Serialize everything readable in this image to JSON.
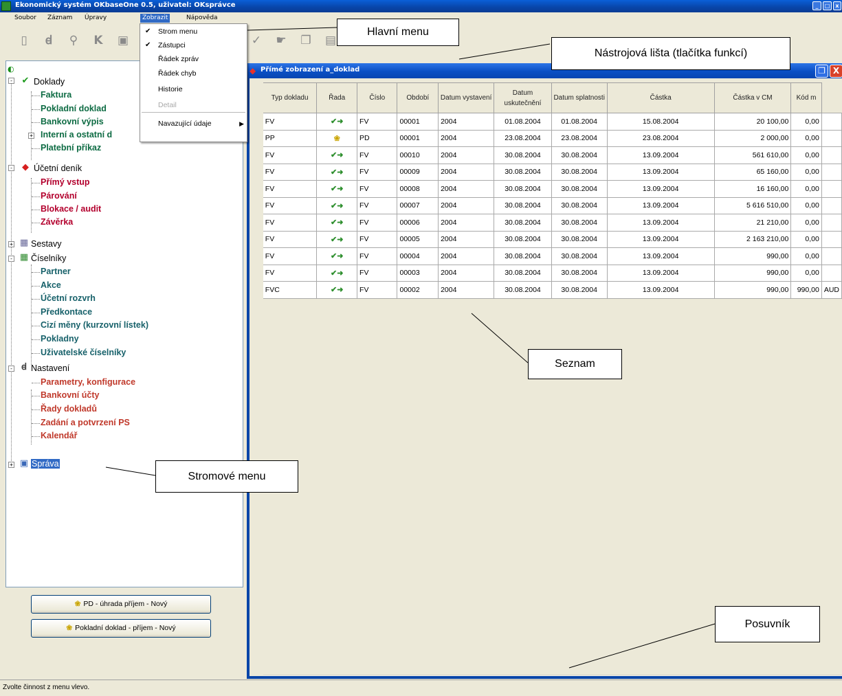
{
  "window": {
    "title": "Ekonomický systém OKbaseOne 0.5, uživatel: OKsprávce"
  },
  "menubar": {
    "items": [
      {
        "label": "Soubor"
      },
      {
        "label": "Záznam"
      },
      {
        "label": "Úpravy"
      },
      {
        "label": "Zobrazit",
        "active": true
      },
      {
        "label": "Nápověda"
      }
    ]
  },
  "view_menu": {
    "items": [
      {
        "label": "Strom menu",
        "checked": true,
        "enabled": true
      },
      {
        "label": "Zástupci",
        "checked": true,
        "enabled": true
      },
      {
        "label": "Řádek zpráv",
        "checked": false,
        "enabled": true
      },
      {
        "label": "Řádek chyb",
        "checked": false,
        "enabled": true
      },
      {
        "label": "Historie",
        "checked": false,
        "enabled": true
      },
      {
        "label": "Detail",
        "checked": false,
        "enabled": false
      },
      {
        "label": "Navazující údaje",
        "checked": false,
        "enabled": true,
        "submenu": true
      }
    ]
  },
  "toolbar": {
    "icons": [
      "new-document-icon",
      "wrench-icon",
      "magnifier-icon",
      "k-icon",
      "save-icon",
      "check-icon",
      "hand-icon",
      "copy-icon",
      "print-icon",
      "document-icon",
      "document-icon",
      "document-icon",
      "document-icon",
      "info-icon"
    ]
  },
  "tree": {
    "sections": [
      {
        "label": "Doklady",
        "icon": "check-document-icon",
        "items": [
          {
            "label": "Faktura",
            "color": "green"
          },
          {
            "label": "Pokladní doklad",
            "color": "green"
          },
          {
            "label": "Bankovní výpis",
            "color": "green"
          },
          {
            "label": "Interní a ostatní d",
            "color": "green",
            "expandable": true
          },
          {
            "label": "Platební příkaz",
            "color": "green"
          }
        ]
      },
      {
        "label": "Účetní deník",
        "icon": "book-icon",
        "items": [
          {
            "label": "Přímý vstup",
            "color": "red"
          },
          {
            "label": "Párování",
            "color": "red"
          },
          {
            "label": "Blokace / audit",
            "color": "red"
          },
          {
            "label": "Závěrka",
            "color": "red"
          }
        ]
      },
      {
        "label": "Sestavy",
        "icon": "report-icon",
        "items": []
      },
      {
        "label": "Číselníky",
        "icon": "table-icon",
        "items": [
          {
            "label": "Partner",
            "color": "teal"
          },
          {
            "label": "Akce",
            "color": "teal"
          },
          {
            "label": "Účetní rozvrh",
            "color": "teal"
          },
          {
            "label": "Předkontace",
            "color": "teal"
          },
          {
            "label": "Cizí měny (kurzovní lístek)",
            "color": "teal"
          },
          {
            "label": "Pokladny",
            "color": "teal"
          },
          {
            "label": "Uživatelské číselníky",
            "color": "teal"
          }
        ]
      },
      {
        "label": "Nastavení",
        "icon": "wrench-icon",
        "items": [
          {
            "label": "Parametry, konfigurace",
            "color": "orange"
          },
          {
            "label": "Bankovní účty",
            "color": "orange"
          },
          {
            "label": "Řady dokladů",
            "color": "orange"
          },
          {
            "label": "Zadání a potvrzení PS",
            "color": "orange"
          },
          {
            "label": "Kalendář",
            "color": "orange"
          }
        ]
      },
      {
        "label": "Správa",
        "icon": "computer-icon",
        "selected": true,
        "items": []
      }
    ]
  },
  "shortcuts": {
    "buttons": [
      {
        "label": "PD - úhrada příjem - Nový",
        "icon": "coins-icon"
      },
      {
        "label": "Pokladní doklad - příjem - Nový",
        "icon": "coins-icon"
      }
    ]
  },
  "document_window": {
    "title": "Přímé zobrazení a_doklad",
    "columns": [
      "Typ dokladu",
      "Řada",
      "Číslo",
      "Období",
      "Datum vystavení",
      "Datum uskutečnění",
      "Datum splatnosti",
      "Částka",
      "Částka v CM",
      "Kód m"
    ],
    "rows": [
      {
        "typ": "FV",
        "icon": "green",
        "rada": "FV",
        "cislo": "00001",
        "obdobi": "2004",
        "vystaveni": "01.08.2004",
        "uskutecneni": "01.08.2004",
        "splatnosti": "15.08.2004",
        "castka": "20 100,00",
        "castka_cm": "0,00",
        "kod": ""
      },
      {
        "typ": "PP",
        "icon": "yellow",
        "rada": "PD",
        "cislo": "00001",
        "obdobi": "2004",
        "vystaveni": "23.08.2004",
        "uskutecneni": "23.08.2004",
        "splatnosti": "23.08.2004",
        "castka": "2 000,00",
        "castka_cm": "0,00",
        "kod": ""
      },
      {
        "typ": "FV",
        "icon": "green",
        "rada": "FV",
        "cislo": "00010",
        "obdobi": "2004",
        "vystaveni": "30.08.2004",
        "uskutecneni": "30.08.2004",
        "splatnosti": "13.09.2004",
        "castka": "561 610,00",
        "castka_cm": "0,00",
        "kod": ""
      },
      {
        "typ": "FV",
        "icon": "green",
        "rada": "FV",
        "cislo": "00009",
        "obdobi": "2004",
        "vystaveni": "30.08.2004",
        "uskutecneni": "30.08.2004",
        "splatnosti": "13.09.2004",
        "castka": "65 160,00",
        "castka_cm": "0,00",
        "kod": ""
      },
      {
        "typ": "FV",
        "icon": "green",
        "rada": "FV",
        "cislo": "00008",
        "obdobi": "2004",
        "vystaveni": "30.08.2004",
        "uskutecneni": "30.08.2004",
        "splatnosti": "13.09.2004",
        "castka": "16 160,00",
        "castka_cm": "0,00",
        "kod": ""
      },
      {
        "typ": "FV",
        "icon": "green",
        "rada": "FV",
        "cislo": "00007",
        "obdobi": "2004",
        "vystaveni": "30.08.2004",
        "uskutecneni": "30.08.2004",
        "splatnosti": "13.09.2004",
        "castka": "5 616 510,00",
        "castka_cm": "0,00",
        "kod": ""
      },
      {
        "typ": "FV",
        "icon": "green",
        "rada": "FV",
        "cislo": "00006",
        "obdobi": "2004",
        "vystaveni": "30.08.2004",
        "uskutecneni": "30.08.2004",
        "splatnosti": "13.09.2004",
        "castka": "21 210,00",
        "castka_cm": "0,00",
        "kod": ""
      },
      {
        "typ": "FV",
        "icon": "green",
        "rada": "FV",
        "cislo": "00005",
        "obdobi": "2004",
        "vystaveni": "30.08.2004",
        "uskutecneni": "30.08.2004",
        "splatnosti": "13.09.2004",
        "castka": "2 163 210,00",
        "castka_cm": "0,00",
        "kod": ""
      },
      {
        "typ": "FV",
        "icon": "green",
        "rada": "FV",
        "cislo": "00004",
        "obdobi": "2004",
        "vystaveni": "30.08.2004",
        "uskutecneni": "30.08.2004",
        "splatnosti": "13.09.2004",
        "castka": "990,00",
        "castka_cm": "0,00",
        "kod": ""
      },
      {
        "typ": "FV",
        "icon": "green",
        "rada": "FV",
        "cislo": "00003",
        "obdobi": "2004",
        "vystaveni": "30.08.2004",
        "uskutecneni": "30.08.2004",
        "splatnosti": "13.09.2004",
        "castka": "990,00",
        "castka_cm": "0,00",
        "kod": ""
      },
      {
        "typ": "FVC",
        "icon": "green-yellow",
        "rada": "FV",
        "cislo": "00002",
        "obdobi": "2004",
        "vystaveni": "30.08.2004",
        "uskutecneni": "30.08.2004",
        "splatnosti": "13.09.2004",
        "castka": "990,00",
        "castka_cm": "990,00",
        "kod": "AUD"
      }
    ]
  },
  "statusbar": {
    "text": "Zvolte činnost z menu vlevo."
  },
  "annotations": {
    "main_menu": "Hlavní menu",
    "toolbar": "Nástrojová lišta (tlačítka funkcí)",
    "list": "Seznam",
    "tree_menu": "Stromové menu",
    "scrollbar": "Posuvník"
  },
  "colors": {
    "title_blue": "#0845a8",
    "menu_highlight": "#316ac5",
    "tree_green": "#0d6b43",
    "tree_red": "#b3002d",
    "tree_teal": "#17616a",
    "tree_orange": "#c0392b",
    "window_bg": "#ece9d8"
  }
}
